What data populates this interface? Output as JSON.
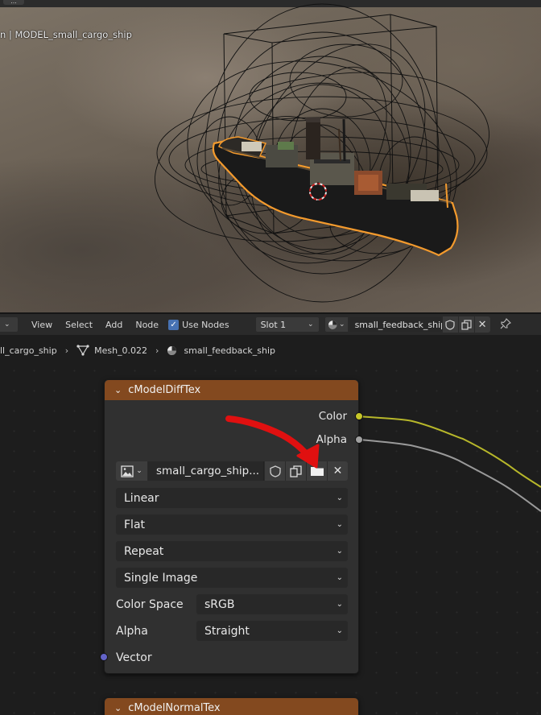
{
  "viewport": {
    "object_label": "n | MODEL_small_cargo_ship",
    "menu_stub": "..."
  },
  "header": {
    "menus": [
      "View",
      "Select",
      "Add",
      "Node"
    ],
    "use_nodes_label": "Use Nodes",
    "use_nodes_checked": true,
    "slot_label": "Slot 1",
    "material_name": "small_feedback_ship"
  },
  "breadcrumb": {
    "object": "ll_cargo_ship",
    "mesh": "Mesh_0.022",
    "material": "small_feedback_ship"
  },
  "node_difftex": {
    "title": "cModelDiffTex",
    "outputs": [
      "Color",
      "Alpha"
    ],
    "image_name": "small_cargo_ship...",
    "interpolation": "Linear",
    "projection": "Flat",
    "extension": "Repeat",
    "source": "Single Image",
    "color_space_label": "Color Space",
    "color_space_value": "sRGB",
    "alpha_label": "Alpha",
    "alpha_value": "Straight",
    "input_label": "Vector"
  },
  "node_normaltex": {
    "title": "cModelNormalTex"
  },
  "colors": {
    "node_header": "#83491f",
    "socket_color": "#c7c729",
    "socket_gray": "#a1a1a1",
    "socket_vector": "#6363c7",
    "annotation_arrow": "#e01010",
    "selection_outline": "#f39a2d"
  }
}
